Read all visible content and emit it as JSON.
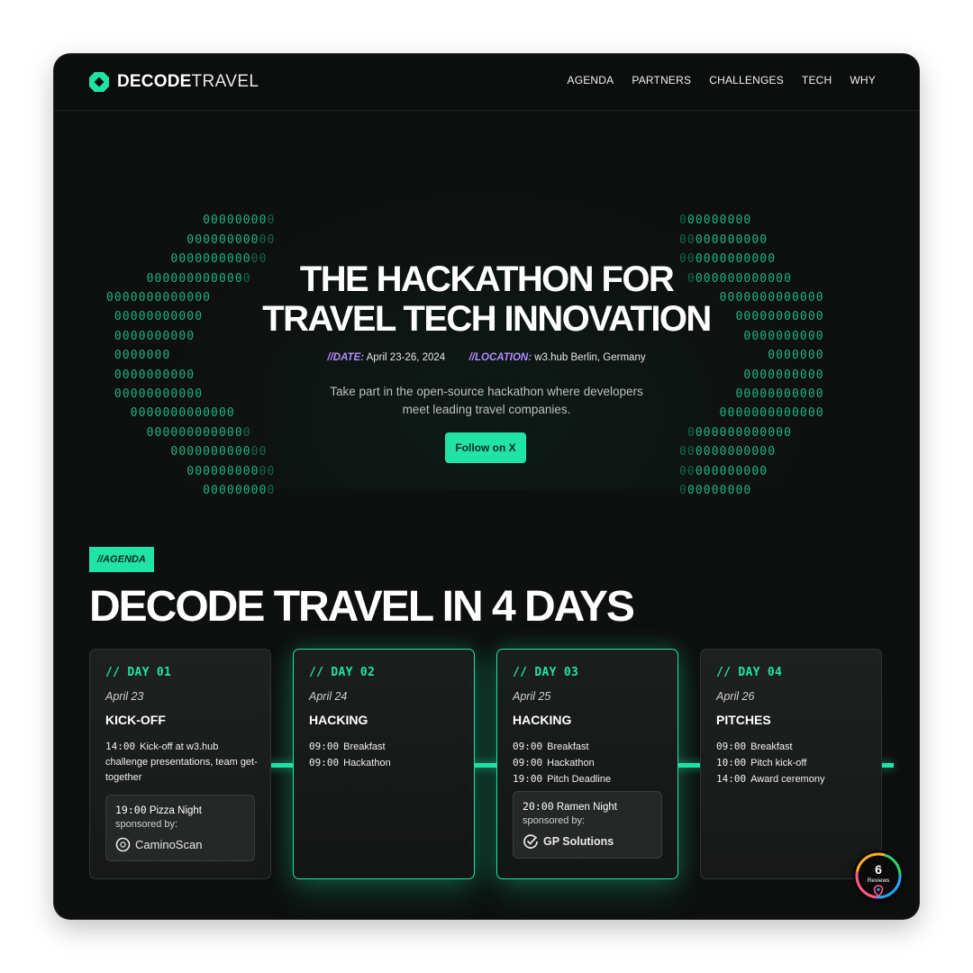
{
  "brand": {
    "bold": "DECODE",
    "light": "TRAVEL"
  },
  "nav": {
    "items": [
      "AGENDA",
      "PARTNERS",
      "CHALLENGES",
      "TECH",
      "WHY"
    ]
  },
  "hero": {
    "title_line1": "THE HACKATHON FOR",
    "title_line2": "TRAVEL TECH INNOVATION",
    "date_key": "//DATE:",
    "date_value": "April 23-26, 2024",
    "location_key": "//LOCATION:",
    "location_value": "w3.hub Berlin, Germany",
    "desc_line1": "Take part in the open-source hackathon where developers",
    "desc_line2": "meet leading travel companies.",
    "cta": "Follow on X"
  },
  "agenda": {
    "tag": "//AGENDA",
    "title": "DECODE TRAVEL IN 4 DAYS",
    "days": [
      {
        "label": "// DAY 01",
        "date": "April 23",
        "title": "KICK-OFF",
        "events": [
          {
            "time": "14:00",
            "text": "Kick-off at w3.hub challenge presentations, team get-together"
          }
        ],
        "sponsor": {
          "time": "19:00",
          "event": "Pizza Night",
          "note": "sponsored by:",
          "brand": "CaminoScan"
        }
      },
      {
        "label": "// DAY 02",
        "date": "April 24",
        "title": "HACKING",
        "events": [
          {
            "time": "09:00",
            "text": "Breakfast"
          },
          {
            "time": "09:00",
            "text": "Hackathon"
          }
        ]
      },
      {
        "label": "// DAY 03",
        "date": "April 25",
        "title": "HACKING",
        "events": [
          {
            "time": "09:00",
            "text": "Breakfast"
          },
          {
            "time": "09:00",
            "text": "Hackathon"
          },
          {
            "time": "19:00",
            "text": "Pitch Deadline"
          }
        ],
        "sponsor": {
          "time": "20:00",
          "event": "Ramen Night",
          "note": "sponsored by:",
          "brand": "GP Solutions"
        }
      },
      {
        "label": "// DAY 04",
        "date": "April 26",
        "title": "PITCHES",
        "events": [
          {
            "time": "09:00",
            "text": "Breakfast"
          },
          {
            "time": "10:00",
            "text": "Pitch kick-off"
          },
          {
            "time": "14:00",
            "text": "Award ceremony"
          }
        ]
      }
    ]
  },
  "reviews": {
    "count": "6",
    "label": "Reviews"
  },
  "colors": {
    "accent": "#20e3a6",
    "meta_key": "#b48cff",
    "background": "#0e0f0f"
  }
}
